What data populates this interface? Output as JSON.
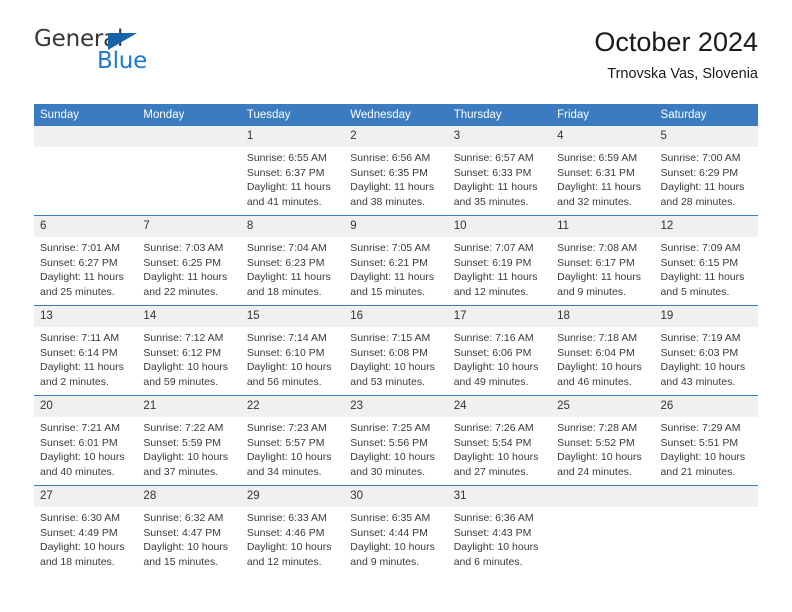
{
  "brand": {
    "name_part1": "General",
    "name_part2": "Blue",
    "triangle_color": "#1763a8",
    "blue_color": "#1c7ad1"
  },
  "header": {
    "title": "October 2024",
    "subtitle": "Trnovska Vas, Slovenia"
  },
  "theme": {
    "header_blue": "#3b7cc0",
    "daynum_band": "#f0f0f0",
    "text": "#3a3a3a"
  },
  "weekdays": [
    "Sunday",
    "Monday",
    "Tuesday",
    "Wednesday",
    "Thursday",
    "Friday",
    "Saturday"
  ],
  "weeks": [
    [
      {
        "day": "",
        "lines": []
      },
      {
        "day": "",
        "lines": []
      },
      {
        "day": "1",
        "lines": [
          "Sunrise: 6:55 AM",
          "Sunset: 6:37 PM",
          "Daylight: 11 hours",
          "and 41 minutes."
        ]
      },
      {
        "day": "2",
        "lines": [
          "Sunrise: 6:56 AM",
          "Sunset: 6:35 PM",
          "Daylight: 11 hours",
          "and 38 minutes."
        ]
      },
      {
        "day": "3",
        "lines": [
          "Sunrise: 6:57 AM",
          "Sunset: 6:33 PM",
          "Daylight: 11 hours",
          "and 35 minutes."
        ]
      },
      {
        "day": "4",
        "lines": [
          "Sunrise: 6:59 AM",
          "Sunset: 6:31 PM",
          "Daylight: 11 hours",
          "and 32 minutes."
        ]
      },
      {
        "day": "5",
        "lines": [
          "Sunrise: 7:00 AM",
          "Sunset: 6:29 PM",
          "Daylight: 11 hours",
          "and 28 minutes."
        ]
      }
    ],
    [
      {
        "day": "6",
        "lines": [
          "Sunrise: 7:01 AM",
          "Sunset: 6:27 PM",
          "Daylight: 11 hours",
          "and 25 minutes."
        ]
      },
      {
        "day": "7",
        "lines": [
          "Sunrise: 7:03 AM",
          "Sunset: 6:25 PM",
          "Daylight: 11 hours",
          "and 22 minutes."
        ]
      },
      {
        "day": "8",
        "lines": [
          "Sunrise: 7:04 AM",
          "Sunset: 6:23 PM",
          "Daylight: 11 hours",
          "and 18 minutes."
        ]
      },
      {
        "day": "9",
        "lines": [
          "Sunrise: 7:05 AM",
          "Sunset: 6:21 PM",
          "Daylight: 11 hours",
          "and 15 minutes."
        ]
      },
      {
        "day": "10",
        "lines": [
          "Sunrise: 7:07 AM",
          "Sunset: 6:19 PM",
          "Daylight: 11 hours",
          "and 12 minutes."
        ]
      },
      {
        "day": "11",
        "lines": [
          "Sunrise: 7:08 AM",
          "Sunset: 6:17 PM",
          "Daylight: 11 hours",
          "and 9 minutes."
        ]
      },
      {
        "day": "12",
        "lines": [
          "Sunrise: 7:09 AM",
          "Sunset: 6:15 PM",
          "Daylight: 11 hours",
          "and 5 minutes."
        ]
      }
    ],
    [
      {
        "day": "13",
        "lines": [
          "Sunrise: 7:11 AM",
          "Sunset: 6:14 PM",
          "Daylight: 11 hours",
          "and 2 minutes."
        ]
      },
      {
        "day": "14",
        "lines": [
          "Sunrise: 7:12 AM",
          "Sunset: 6:12 PM",
          "Daylight: 10 hours",
          "and 59 minutes."
        ]
      },
      {
        "day": "15",
        "lines": [
          "Sunrise: 7:14 AM",
          "Sunset: 6:10 PM",
          "Daylight: 10 hours",
          "and 56 minutes."
        ]
      },
      {
        "day": "16",
        "lines": [
          "Sunrise: 7:15 AM",
          "Sunset: 6:08 PM",
          "Daylight: 10 hours",
          "and 53 minutes."
        ]
      },
      {
        "day": "17",
        "lines": [
          "Sunrise: 7:16 AM",
          "Sunset: 6:06 PM",
          "Daylight: 10 hours",
          "and 49 minutes."
        ]
      },
      {
        "day": "18",
        "lines": [
          "Sunrise: 7:18 AM",
          "Sunset: 6:04 PM",
          "Daylight: 10 hours",
          "and 46 minutes."
        ]
      },
      {
        "day": "19",
        "lines": [
          "Sunrise: 7:19 AM",
          "Sunset: 6:03 PM",
          "Daylight: 10 hours",
          "and 43 minutes."
        ]
      }
    ],
    [
      {
        "day": "20",
        "lines": [
          "Sunrise: 7:21 AM",
          "Sunset: 6:01 PM",
          "Daylight: 10 hours",
          "and 40 minutes."
        ]
      },
      {
        "day": "21",
        "lines": [
          "Sunrise: 7:22 AM",
          "Sunset: 5:59 PM",
          "Daylight: 10 hours",
          "and 37 minutes."
        ]
      },
      {
        "day": "22",
        "lines": [
          "Sunrise: 7:23 AM",
          "Sunset: 5:57 PM",
          "Daylight: 10 hours",
          "and 34 minutes."
        ]
      },
      {
        "day": "23",
        "lines": [
          "Sunrise: 7:25 AM",
          "Sunset: 5:56 PM",
          "Daylight: 10 hours",
          "and 30 minutes."
        ]
      },
      {
        "day": "24",
        "lines": [
          "Sunrise: 7:26 AM",
          "Sunset: 5:54 PM",
          "Daylight: 10 hours",
          "and 27 minutes."
        ]
      },
      {
        "day": "25",
        "lines": [
          "Sunrise: 7:28 AM",
          "Sunset: 5:52 PM",
          "Daylight: 10 hours",
          "and 24 minutes."
        ]
      },
      {
        "day": "26",
        "lines": [
          "Sunrise: 7:29 AM",
          "Sunset: 5:51 PM",
          "Daylight: 10 hours",
          "and 21 minutes."
        ]
      }
    ],
    [
      {
        "day": "27",
        "lines": [
          "Sunrise: 6:30 AM",
          "Sunset: 4:49 PM",
          "Daylight: 10 hours",
          "and 18 minutes."
        ]
      },
      {
        "day": "28",
        "lines": [
          "Sunrise: 6:32 AM",
          "Sunset: 4:47 PM",
          "Daylight: 10 hours",
          "and 15 minutes."
        ]
      },
      {
        "day": "29",
        "lines": [
          "Sunrise: 6:33 AM",
          "Sunset: 4:46 PM",
          "Daylight: 10 hours",
          "and 12 minutes."
        ]
      },
      {
        "day": "30",
        "lines": [
          "Sunrise: 6:35 AM",
          "Sunset: 4:44 PM",
          "Daylight: 10 hours",
          "and 9 minutes."
        ]
      },
      {
        "day": "31",
        "lines": [
          "Sunrise: 6:36 AM",
          "Sunset: 4:43 PM",
          "Daylight: 10 hours",
          "and 6 minutes."
        ]
      },
      {
        "day": "",
        "lines": []
      },
      {
        "day": "",
        "lines": []
      }
    ]
  ]
}
